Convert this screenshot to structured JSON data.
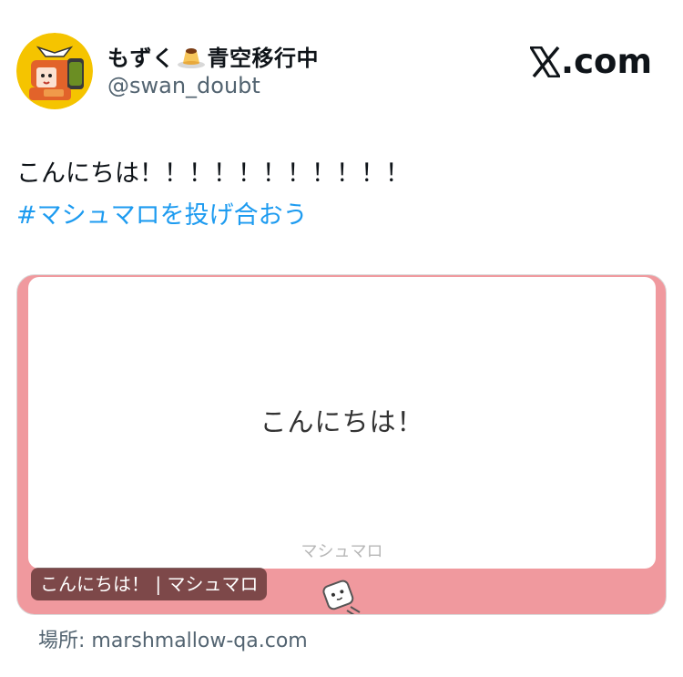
{
  "author": {
    "name_prefix": "もずく",
    "name_emoji": "pudding-icon",
    "name_suffix": "青空移行中",
    "handle": "@swan_doubt",
    "avatar": "avatar-illustration"
  },
  "brand": {
    "label": ".com",
    "icon": "x-logo-icon"
  },
  "tweet": {
    "text": "こんにちは！！！！！！！！！！！",
    "hashtag": "#マシュマロを投げ合おう"
  },
  "card": {
    "message": "こんにちは！",
    "service_label": "マシュマロ",
    "caption": "こんにちは！ | マシュマロ",
    "mascot": "marshmallow-mascot-icon",
    "colors": {
      "frame": "#f0999e",
      "caption_bg": "#7a4a4a"
    }
  },
  "source": {
    "text": "場所: marshmallow-qa.com"
  },
  "colors": {
    "link": "#1d9bf0",
    "secondary_text": "#536471"
  }
}
